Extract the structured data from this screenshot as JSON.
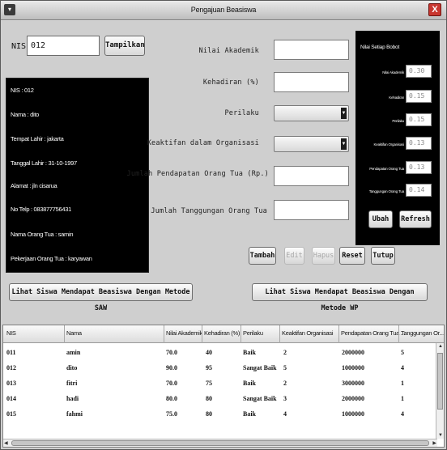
{
  "window": {
    "title": "Pengajuan Beasiswa",
    "sysmenu_icon": "window-menu-icon",
    "close_icon": "close-icon",
    "close_glyph": "X"
  },
  "search": {
    "nis_label": "NIS",
    "nis_value": "012",
    "tampilkan_label": "Tampilkan"
  },
  "student_info": [
    "NIS : 012",
    "Nama : dito",
    "Tempat Lahir : jakarta",
    "Tanggal Lahir : 31-10-1997",
    "Alamat : jln cisarua",
    "No Telp : 083877756431",
    "Nama Orang Tua : samin",
    "Pekerjaan Orang Tua : karyawan"
  ],
  "form": {
    "nilai_akademik": "Nilai Akademik",
    "kehadiran": "Kehadiran (%)",
    "perilaku": "Perilaku",
    "keaktifan": "Keaktifan dalam Organisasi",
    "pendapatan": "Jumlah Pendapatan Orang Tua (Rp.)",
    "tanggungan": "Jumlah Tanggungan Orang Tua"
  },
  "actions": {
    "tambah": "Tambah",
    "edit": "Edit",
    "hapus": "Hapus",
    "reset": "Reset",
    "tutup": "Tutup"
  },
  "bobot": {
    "title": "Nilai Setiap Bobot",
    "items": [
      {
        "label": "Nilai Akademik",
        "value": "0.30"
      },
      {
        "label": "Kehadiran",
        "value": "0.15"
      },
      {
        "label": "Perilaku",
        "value": "0.15"
      },
      {
        "label": "Keaktifan Organisasi",
        "value": "0.13"
      },
      {
        "label": "Pendapatan Orang Tua",
        "value": "0.13"
      },
      {
        "label": "Tanggungan Orang Tua",
        "value": "0.14"
      }
    ],
    "ubah": "Ubah",
    "refresh": "Refresh"
  },
  "views": {
    "saw": "Lihat Siswa Mendapat Beasiswa Dengan Metode SAW",
    "wp": "Lihat Siswa Mendapat Beasiswa Dengan Metode WP"
  },
  "table": {
    "columns": [
      "NIS",
      "Nama",
      "Nilai Akademik",
      "Kehadiran (%)",
      "Perilaku",
      "Keaktifan Organisasi",
      "Pendapatan Orang Tua ...",
      "Tanggungan Or..."
    ],
    "rows": [
      [
        "011",
        "amin",
        "70.0",
        "40",
        "Baik",
        "2",
        "2000000",
        "5"
      ],
      [
        "012",
        "dito",
        "90.0",
        "95",
        "Sangat Baik",
        "5",
        "1000000",
        "4"
      ],
      [
        "013",
        "fitri",
        "70.0",
        "75",
        "Baik",
        "2",
        "3000000",
        "1"
      ],
      [
        "014",
        "hadi",
        "80.0",
        "80",
        "Sangat Baik",
        "3",
        "2000000",
        "1"
      ],
      [
        "015",
        "fahmi",
        "75.0",
        "80",
        "Baik",
        "4",
        "1000000",
        "4"
      ]
    ]
  }
}
